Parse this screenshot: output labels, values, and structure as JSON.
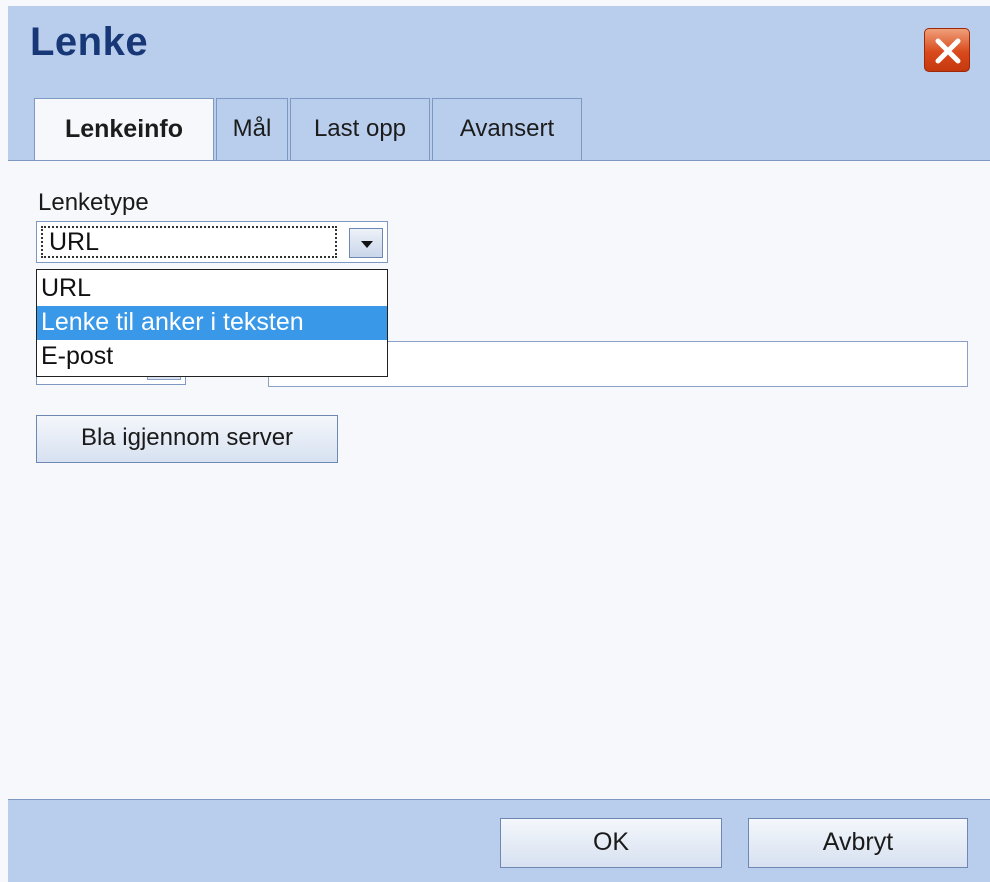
{
  "dialog": {
    "title": "Lenke",
    "close_icon": "close-icon"
  },
  "tabs": [
    {
      "label": "Lenkeinfo",
      "active": true
    },
    {
      "label": "Mål",
      "active": false
    },
    {
      "label": "Last opp",
      "active": false
    },
    {
      "label": "Avansert",
      "active": false
    }
  ],
  "link_type": {
    "label": "Lenketype",
    "selected": "URL",
    "options": [
      "URL",
      "Lenke til anker i teksten",
      "E-post"
    ],
    "highlighted_option": "Lenke til anker i teksten"
  },
  "url_field": {
    "value": ""
  },
  "browse_button_label": "Bla igjennom server",
  "footer": {
    "ok_label": "OK",
    "cancel_label": "Avbryt"
  },
  "colors": {
    "frame": "#b9cdec",
    "title": "#173777",
    "highlight": "#3a98e8",
    "close": "#d84a1c"
  }
}
